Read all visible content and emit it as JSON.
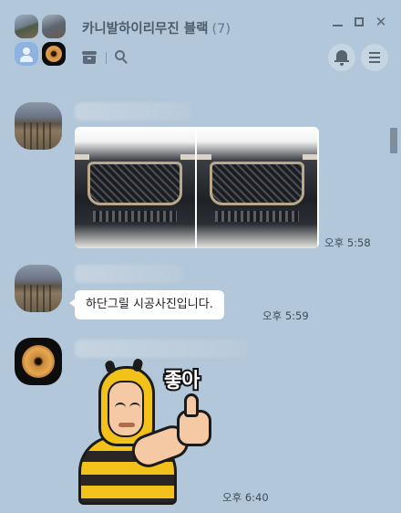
{
  "header": {
    "title": "카니발하이리무진 블랙",
    "member_count": "(7)",
    "window_controls": {
      "minimize": "minimize",
      "maximize": "maximize",
      "close": "✕"
    },
    "icons": [
      "drawer-icon",
      "search-icon",
      "bell-icon",
      "menu-icon"
    ]
  },
  "messages": [
    {
      "type": "photos",
      "photo_count": 2,
      "time": "오후 5:58",
      "avatar": "rail-track-photo"
    },
    {
      "type": "text",
      "text": "하단그릴 시공사진입니다.",
      "time": "오후 5:59",
      "avatar": "rail-track-photo"
    },
    {
      "type": "sticker",
      "sticker_text": "좋아",
      "time": "오후 6:40",
      "avatar": "donut-photo"
    }
  ],
  "colors": {
    "background": "#b2c7d9",
    "bubble": "#ffffff",
    "title": "#4e5b68"
  }
}
